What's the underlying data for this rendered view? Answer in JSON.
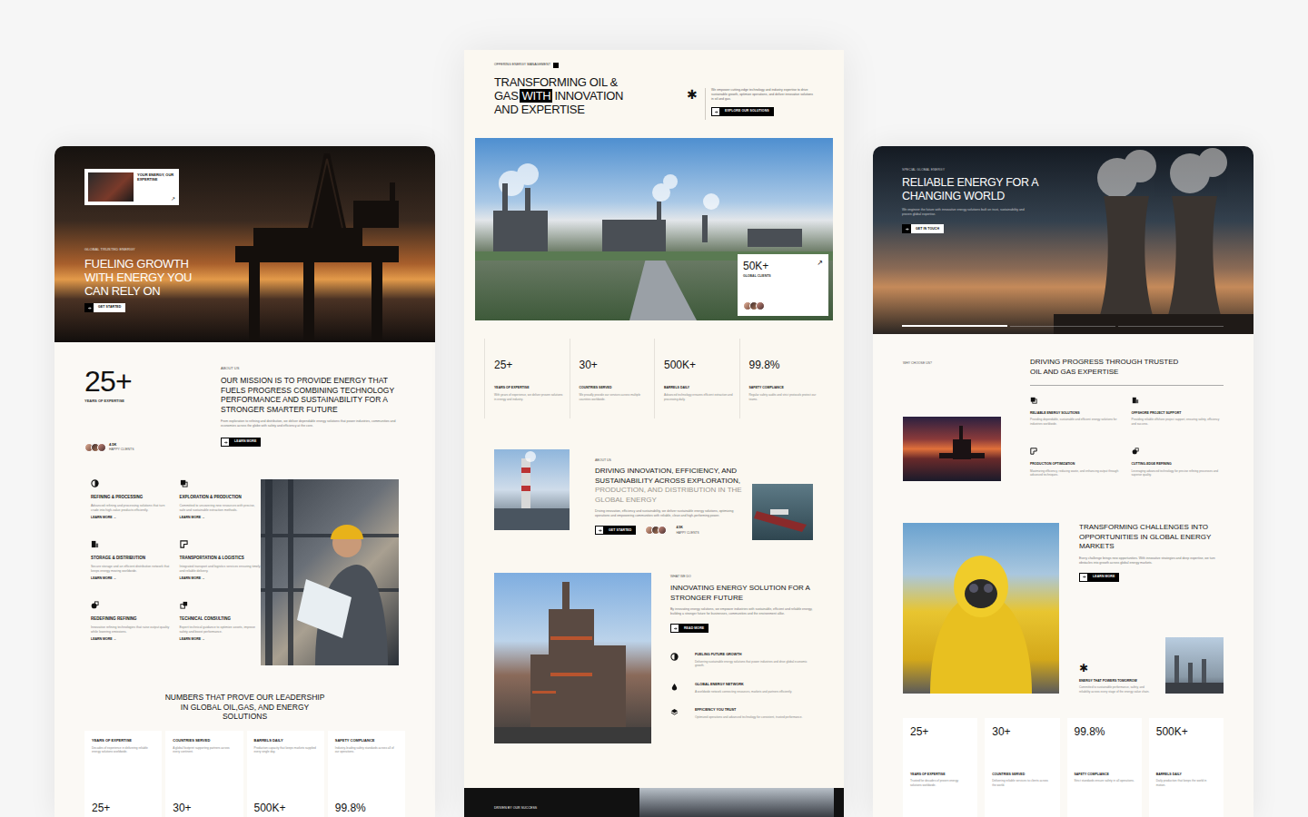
{
  "left": {
    "hero": {
      "badge_title": "YOUR ENERGY, OUR EXPERTISE",
      "badge_arrow": "↗",
      "eyebrow": "GLOBAL TRUSTED ENERGY",
      "title": "FUELING GROWTH WITH ENERGY YOU CAN RELY ON",
      "button": "GET STARTED"
    },
    "intro": {
      "stat": "25+",
      "stat_label": "YEARS OF EXPERTISE",
      "clients": "4.5K",
      "clients_label": "HAPPY CLIENTS",
      "eyebrow": "ABOUT US",
      "title": "OUR MISSION IS TO PROVIDE ENERGY THAT FUELS PROGRESS COMBINING TECHNOLOGY PERFORMANCE AND SUSTAINABILITY FOR A STRONGER SMARTER FUTURE",
      "text": "From exploration to refining and distribution, we deliver dependable energy solutions that power industries, communities and economies across the globe with safety and efficiency at the core.",
      "button": "LEARN MORE"
    },
    "services": [
      {
        "title": "REFINING & PROCESSING",
        "text": "Advanced refining and processing solutions that turn crude into high-value products efficiently.",
        "link": "LEARN MORE →"
      },
      {
        "title": "EXPLORATION & PRODUCTION",
        "text": "Committed to uncovering new resources with precise, safe and sustainable extraction methods.",
        "link": "LEARN MORE →"
      },
      {
        "title": "STORAGE & DISTRIBUTION",
        "text": "Secure storage and an efficient distribution network that keeps energy moving worldwide.",
        "link": "LEARN MORE →"
      },
      {
        "title": "TRANSPORTATION & LOGISTICS",
        "text": "Integrated transport and logistics services ensuring timely and reliable delivery.",
        "link": "LEARN MORE →"
      },
      {
        "title": "REDEFINING REFINING",
        "text": "Innovative refining technologies that raise output quality while lowering emissions.",
        "link": "LEARN MORE →"
      },
      {
        "title": "TECHNICAL CONSULTING",
        "text": "Expert technical guidance to optimize assets, improve safety and boost performance.",
        "link": "LEARN MORE →"
      }
    ],
    "numbers": {
      "title": "NUMBERS THAT PROVE OUR LEADERSHIP IN GLOBAL OIL,GAS, AND ENERGY SOLUTIONS",
      "items": [
        {
          "label": "YEARS OF EXPERTISE",
          "text": "Decades of experience in delivering reliable energy solutions worldwide.",
          "value": "25+"
        },
        {
          "label": "COUNTRIES SERVED",
          "text": "A global footprint supporting partners across every continent.",
          "value": "30+"
        },
        {
          "label": "BARRELS DAILY",
          "text": "Production capacity that keeps markets supplied every single day.",
          "value": "500K+"
        },
        {
          "label": "SAFETY COMPLIANCE",
          "text": "Industry-leading safety standards across all of our operations.",
          "value": "99.8%"
        }
      ]
    }
  },
  "middle": {
    "eyebrow": "OFFERING ENERGY MANAGEMENT",
    "title_parts": [
      {
        "text": "TRANSFORMING OIL & GAS",
        "highlight": false
      },
      {
        "text": "WITH",
        "highlight": true
      },
      {
        "text": "INNOVATION AND EXPERTISE",
        "highlight": false
      }
    ],
    "asterisk": "✱",
    "text": "We empower cutting-edge technology and industry expertise to drive sustainable growth, optimize operations, and deliver innovative solutions in oil and gas.",
    "button": "EXPLORE OUR SOLUTIONS",
    "clients_card": {
      "value": "50K+",
      "label": "GLOBAL CLIENTS",
      "arrow": "↗"
    },
    "stats": [
      {
        "value": "25+",
        "label": "YEARS OF EXPERTISE",
        "text": "With years of experience, we deliver proven solutions in energy and industry."
      },
      {
        "value": "30+",
        "label": "COUNTRIES SERVED",
        "text": "We proudly provide our services across multiple countries worldwide."
      },
      {
        "value": "500K+",
        "label": "BARRELS DAILY",
        "text": "Advanced technology ensures efficient extraction and processing daily."
      },
      {
        "value": "99.8%",
        "label": "SAFETY COMPLIANCE",
        "text": "Regular safety audits and strict protocols protect our teams."
      }
    ],
    "about": {
      "eyebrow": "ABOUT US",
      "title_dark": "DRIVING INNOVATION, EFFICIENCY, AND SUSTAINABILITY ACROSS EXPLORATION,",
      "title_muted": "PRODUCTION, AND DISTRIBUTION IN THE GLOBAL ENERGY",
      "text": "Driving innovation, efficiency and sustainability, we deliver sustainable energy solutions, optimizing operations and empowering communities with reliable, clean and high-performing power.",
      "button": "GET STARTED",
      "clients": "4.5K",
      "clients_label": "HAPPY CLIENTS"
    },
    "whatwedo": {
      "eyebrow": "WHAT WE DO",
      "title": "INNOVATING ENERGY SOLUTION FOR A STRONGER FUTURE",
      "text": "By innovating energy solutions, we empower industries with sustainable, efficient and reliable energy, building a stronger future for businesses, communities and the environment alike.",
      "button": "READ MORE",
      "items": [
        {
          "title": "FUELING FUTURE GROWTH",
          "text": "Delivering sustainable energy solutions that power industries and drive global economic growth."
        },
        {
          "title": "GLOBAL ENERGY NETWORK",
          "text": "A worldwide network connecting resources, markets and partners efficiently."
        },
        {
          "title": "EFFICIENCY YOU TRUST",
          "text": "Optimized operations and advanced technology for consistent, trusted performance."
        }
      ]
    },
    "footer": {
      "title": "DRIVEN BY OUR SUCCESS"
    }
  },
  "right": {
    "hero": {
      "eyebrow": "SPECIAL GLOBAL ENERGY",
      "title": "RELIABLE ENERGY FOR A CHANGING WORLD",
      "text": "We engineer the future with innovative energy solutions built on trust, sustainability and proven global expertise.",
      "button": "GET IN TOUCH",
      "slides": [
        {
          "selected": true
        },
        {
          "selected": false
        },
        {
          "selected": false
        }
      ]
    },
    "why": {
      "eyebrow": "WHY CHOOSE US?",
      "title": "DRIVING PROGRESS THROUGH TRUSTED OIL AND GAS EXPERTISE",
      "features": [
        {
          "title": "RELIABLE ENERGY SOLUTIONS",
          "text": "Providing dependable, sustainable and efficient energy solutions for industries worldwide."
        },
        {
          "title": "OFFSHORE PROJECT SUPPORT",
          "text": "Providing reliable offshore project support, ensuring safety, efficiency and success."
        },
        {
          "title": "PRODUCTION OPTIMIZATION",
          "text": "Maximizing efficiency, reducing waste, and enhancing output through advanced techniques."
        },
        {
          "title": "CUTTING-EDGE REFINING",
          "text": "Leveraging advanced technology for precise refining processes and superior quality."
        }
      ]
    },
    "challenge": {
      "title": "TRANSFORMING CHALLENGES INTO OPPORTUNITIES IN GLOBAL ENERGY MARKETS",
      "text": "Every challenge brings new opportunities. With innovative strategies and deep expertise, we turn obstacles into growth across global energy markets.",
      "button": "LEARN MORE",
      "asterisk": "✱",
      "sub_title": "ENERGY THAT POWERS TOMORROW",
      "sub_text": "Committed to sustainable performance, safety, and reliability across every stage of the energy value chain."
    },
    "stats": [
      {
        "value": "25+",
        "label": "YEARS OF EXPERTISE",
        "text": "Trusted for decades of proven energy solutions worldwide."
      },
      {
        "value": "30+",
        "label": "COUNTRIES SERVED",
        "text": "Delivering reliable services to clients across the world."
      },
      {
        "value": "99.8%",
        "label": "SAFETY COMPLIANCE",
        "text": "Strict standards ensure safety in all operations."
      },
      {
        "value": "500K+",
        "label": "BARRELS DAILY",
        "text": "Daily production that keeps the world in motion."
      }
    ]
  }
}
